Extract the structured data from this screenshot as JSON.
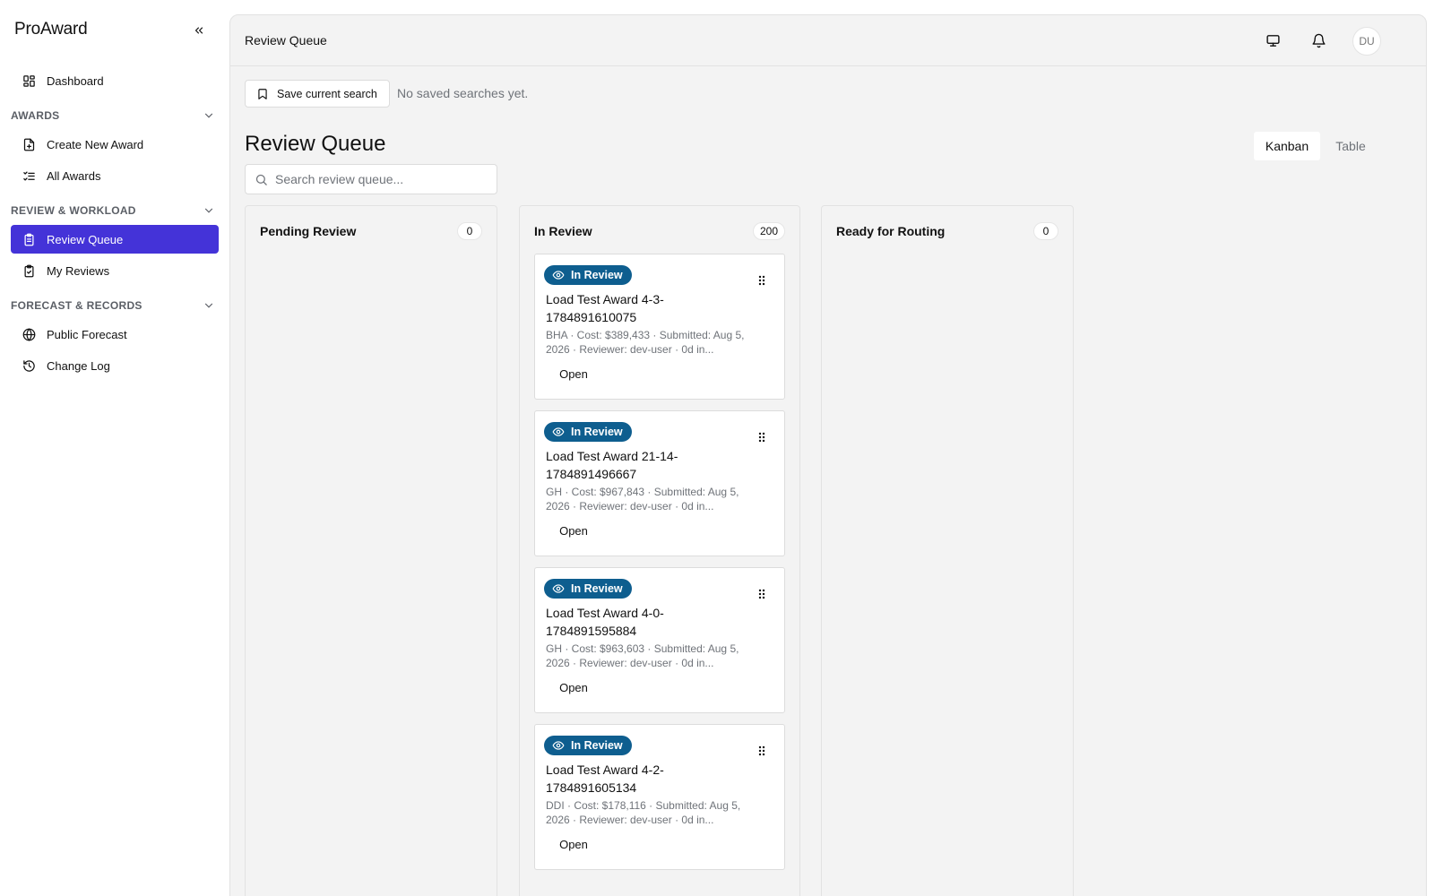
{
  "sidebar": {
    "brand": "ProAward",
    "dashboard": "Dashboard",
    "sections": [
      {
        "title": "AWARDS",
        "items": [
          "Create New Award",
          "All Awards"
        ]
      },
      {
        "title": "REVIEW & WORKLOAD",
        "items": [
          "Review Queue",
          "My Reviews"
        ]
      },
      {
        "title": "FORECAST & RECORDS",
        "items": [
          "Public Forecast",
          "Change Log"
        ]
      }
    ],
    "active_item": "Review Queue"
  },
  "topbar": {
    "title": "Review Queue",
    "avatar_initials": "DU"
  },
  "saved_search": {
    "button_label": "Save current search",
    "empty_text": "No saved searches yet."
  },
  "page": {
    "title": "Review Queue",
    "views": [
      "Kanban",
      "Table"
    ],
    "active_view": "Kanban",
    "search_placeholder": "Search review queue..."
  },
  "board": {
    "columns": [
      {
        "title": "Pending Review",
        "count": "0",
        "cards": []
      },
      {
        "title": "In Review",
        "count": "200",
        "cards": [
          {
            "status": "In Review",
            "title": "Load Test Award 4-3-1784891610075",
            "meta": "BHA · Cost: $389,433 · Submitted: Aug 5, 2026 · Reviewer: dev-user · 0d in...",
            "action": "Open"
          },
          {
            "status": "In Review",
            "title": "Load Test Award 21-14-1784891496667",
            "meta": "GH · Cost: $967,843 · Submitted: Aug 5, 2026 · Reviewer: dev-user · 0d in...",
            "action": "Open"
          },
          {
            "status": "In Review",
            "title": "Load Test Award 4-0-1784891595884",
            "meta": "GH · Cost: $963,603 · Submitted: Aug 5, 2026 · Reviewer: dev-user · 0d in...",
            "action": "Open"
          },
          {
            "status": "In Review",
            "title": "Load Test Award 4-2-1784891605134",
            "meta": "DDI · Cost: $178,116 · Submitted: Aug 5, 2026 · Reviewer: dev-user · 0d in...",
            "action": "Open"
          }
        ]
      },
      {
        "title": "Ready for Routing",
        "count": "0",
        "cards": []
      }
    ]
  },
  "colors": {
    "accent": "#4433d8",
    "status_badge": "#0e5e8f",
    "muted_text": "#6f7379"
  },
  "icons": {
    "collapse": "chevrons-left-icon",
    "dashboard": "layout-grid-icon",
    "create": "file-plus-icon",
    "all_awards": "list-check-icon",
    "review_queue": "clipboard-list-icon",
    "my_reviews": "clipboard-check-icon",
    "public_forecast": "globe-icon",
    "change_log": "history-icon",
    "monitor": "monitor-icon",
    "bell": "bell-icon",
    "bookmark": "bookmark-icon",
    "search": "search-icon",
    "eye": "eye-icon",
    "drag": "grip-vertical-icon"
  }
}
